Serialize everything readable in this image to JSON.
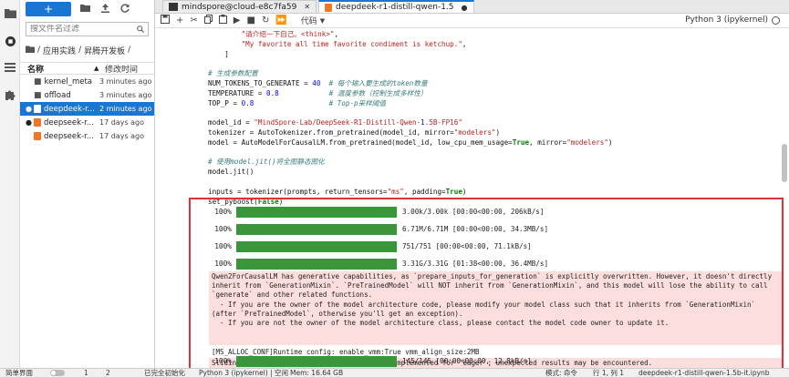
{
  "activity_bar": {
    "icons": [
      "folder-icon",
      "running-icon",
      "list-icon",
      "puzzle-icon"
    ]
  },
  "file_browser": {
    "new_label": "+",
    "search_placeholder": "搜文件名过滤",
    "breadcrumb": [
      "/",
      "应用实践",
      "/",
      "昇腾开发板",
      "/"
    ],
    "col_name": "名称",
    "col_modified": "修改时间",
    "items": [
      {
        "name": "kernel_meta",
        "modified": "3 minutes ago",
        "type": "folder",
        "selected": false,
        "running": false
      },
      {
        "name": "offload",
        "modified": "3 minutes ago",
        "type": "folder",
        "selected": false,
        "running": false
      },
      {
        "name": "deepdeek-r...",
        "modified": "2 minutes ago",
        "type": "notebook",
        "selected": true,
        "running": true
      },
      {
        "name": "deepseek-r...",
        "modified": "17 days ago",
        "type": "notebook",
        "selected": false,
        "running": true
      },
      {
        "name": "deepseek-r...",
        "modified": "17 days ago",
        "type": "notebook",
        "selected": false,
        "running": false
      }
    ]
  },
  "tabs": [
    {
      "label": "mindspore@cloud-e8c7fa59",
      "active": false
    },
    {
      "label": "deepdeek-r1-distill-qwen-1.5",
      "active": true
    }
  ],
  "toolbar": {
    "cell_type": "代码",
    "kernel": "Python 3 (ipykernel)"
  },
  "code_lines": [
    "        \"请介绍一下自己。<think>\",",
    "        \"My favorite all time favorite condiment is ketchup.\",",
    "    ]",
    "",
    "# 生成参数配置",
    "NUM_TOKENS_TO_GENERATE = 40  # 每个输入要生成的token数量",
    "TEMPERATURE = 0.8            # 温度参数（控制生成多样性）",
    "TOP_P = 0.8                  # Top-p采样阈值",
    "",
    "model_id = \"MindSpore-Lab/DeepSeek-R1-Distill-Qwen-1.5B-FP16\"",
    "tokenizer = AutoTokenizer.from_pretrained(model_id, mirror=\"modelers\")",
    "model = AutoModelForCausalLM.from_pretrained(model_id, low_cpu_mem_usage=True, mirror=\"modelers\")",
    "",
    "# 使用model.jit()将全图静态图化",
    "model.jit()",
    "",
    "inputs = tokenizer(prompts, return_tensors=\"ms\", padding=True)",
    "set_pyboost(False)"
  ],
  "progress": [
    {
      "pct": "100%",
      "fraction": 1.0,
      "text": "3.00k/3.00k [00:00<00:00, 206kB/s]"
    },
    {
      "pct": "100%",
      "fraction": 1.0,
      "text": "6.71M/6.71M [00:00<00:00, 34.3MB/s]"
    },
    {
      "pct": "100%",
      "fraction": 1.0,
      "text": "751/751 [00:00<00:00, 71.1kB/s]"
    },
    {
      "pct": "100%",
      "fraction": 1.0,
      "text": "3.31G/3.31G [01:38<00:00, 36.4MB/s]"
    },
    {
      "pct": "100%",
      "fraction": 1.0,
      "text": "145/145 [00:00<00:00, 12.8kB/s]"
    }
  ],
  "stderr_text": "Qwen2ForCausalLM has generative capabilities, as `prepare_inputs_for_generation` is explicitly overwritten. However, it doesn't directly inherit from `GenerationMixin`. `PreTrainedModel` will NOT inherit from `GenerationMixin`, and this model will lose the ability to call `generate` and other related functions.\n  - If you are the owner of the model architecture code, please modify your model class such that it inherits from `GenerationMixin` (after `PreTrainedModel`, otherwise you'll get an exception).\n  - If you are not the owner of the model architecture class, please contact the model code owner to update it.",
  "stdout_text": "[MS_ALLOC_CONF]Runtime config:  enable_vmm:True  vmm_align_size:2MB",
  "stderr2_text": "Sliding Window Attention is enabled but not implemented for `eager`; unexpected results may be encountered.",
  "statusbar": {
    "mode_label": "简单界面",
    "n1": "1",
    "n2": "2",
    "ext_label": "已完全初始化",
    "kernel_label": "Python 3 (ipykernel) | 空闲",
    "mem_label": "Mem: 16.64 GB",
    "mode": "模式: 命令",
    "ln": "行 1, 列 1",
    "file": "deepdeek-r1-distill-qwen-1.5b-it.ipynb"
  },
  "colors": {
    "accent": "#1976d2",
    "progress": "#3b963b",
    "highlight_border": "#e0303a",
    "stderr_bg": "#fddede"
  }
}
